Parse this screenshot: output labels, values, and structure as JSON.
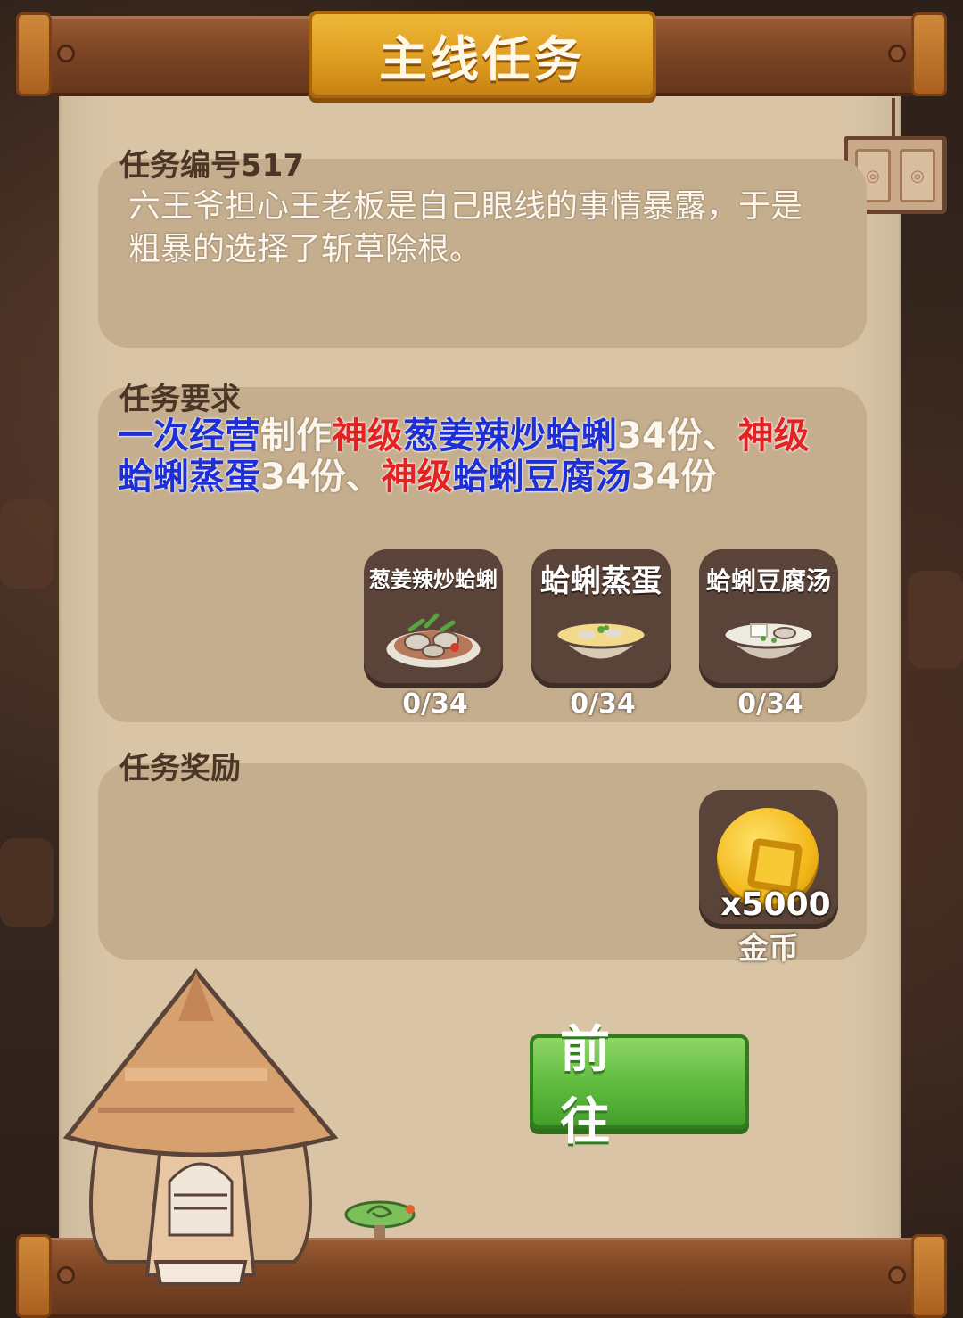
{
  "dialog": {
    "title": "主线任务"
  },
  "task": {
    "id_label": "任务编号517",
    "description": "六王爷担心王老板是自己眼线的事情暴露，于是粗暴的选择了斩草除根。"
  },
  "requirements": {
    "label": "任务要求",
    "segments": [
      {
        "text": "一次经营",
        "color": "blue"
      },
      {
        "text": "制作",
        "color": "white"
      },
      {
        "text": "神级",
        "color": "red"
      },
      {
        "text": "葱姜辣炒蛤蜊",
        "color": "blue"
      },
      {
        "text": "34份、",
        "color": "white"
      },
      {
        "text": "神级",
        "color": "red"
      },
      {
        "text": "蛤蜊蒸蛋",
        "color": "blue"
      },
      {
        "text": "34份、",
        "color": "white"
      },
      {
        "text": "神级",
        "color": "red"
      },
      {
        "text": "蛤蜊豆腐汤",
        "color": "blue"
      },
      {
        "text": "34份",
        "color": "white"
      }
    ],
    "items": [
      {
        "name": "葱姜辣炒蛤蜊",
        "progress": "0/34",
        "icon": "stir-fried-clams-icon"
      },
      {
        "name": "蛤蜊蒸蛋",
        "progress": "0/34",
        "icon": "steamed-egg-clams-icon"
      },
      {
        "name": "蛤蜊豆腐汤",
        "progress": "0/34",
        "icon": "clam-tofu-soup-icon"
      }
    ]
  },
  "rewards": {
    "label": "任务奖励",
    "items": [
      {
        "quantity": "x5000",
        "name": "金币",
        "icon": "gold-coin-icon"
      }
    ]
  },
  "actions": {
    "go_label": "前 往"
  },
  "colors": {
    "blue": "#1e2fd6",
    "red": "#e52222",
    "paper": "#d9c5a6",
    "panel": "#c4ae8e",
    "button_green": "#5dba3e",
    "title_gold": "#dc9b1f"
  }
}
